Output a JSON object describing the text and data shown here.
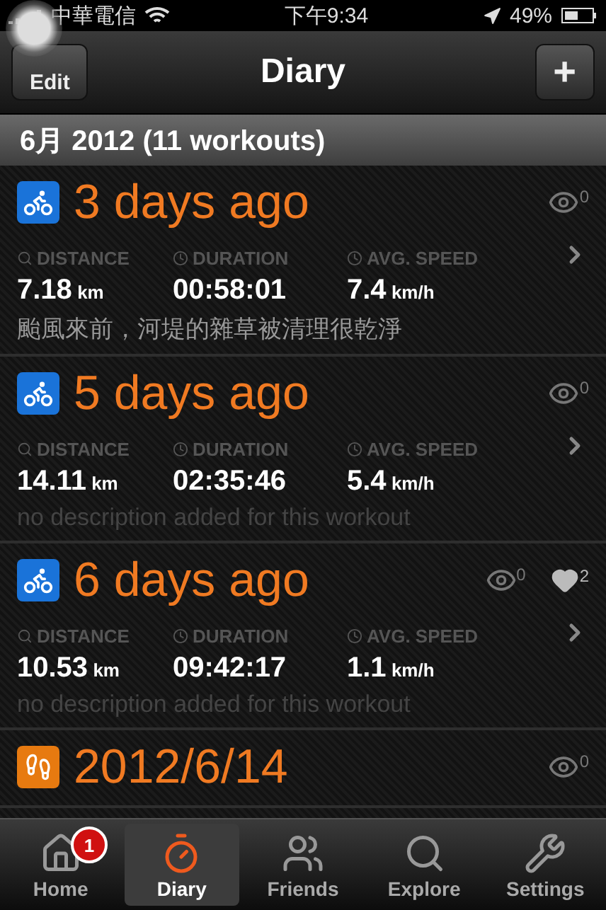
{
  "status_bar": {
    "carrier": "中華電信",
    "time": "下午9:34",
    "battery": "49%"
  },
  "nav": {
    "left_button": "Edit",
    "title": "Diary",
    "right_button": "+"
  },
  "section": {
    "title": "6月 2012 (11 workouts)"
  },
  "workouts": [
    {
      "kind": "bike",
      "title": "3 days ago",
      "views": "0",
      "stats": [
        {
          "label": "DISTANCE",
          "value": "7.18",
          "unit": "km"
        },
        {
          "label": "DURATION",
          "value": "00:58:01"
        },
        {
          "label": "AVG. SPEED",
          "value": "7.4",
          "unit": "km/h"
        }
      ],
      "description": "颱風來前，河堤的雜草被清理很乾淨",
      "description_empty": false
    },
    {
      "kind": "bike",
      "title": "5 days ago",
      "views": "0",
      "stats": [
        {
          "label": "DISTANCE",
          "value": "14.11",
          "unit": "km"
        },
        {
          "label": "DURATION",
          "value": "02:35:46"
        },
        {
          "label": "AVG. SPEED",
          "value": "5.4",
          "unit": "km/h"
        }
      ],
      "description": "no description added for this workout",
      "description_empty": true
    },
    {
      "kind": "bike",
      "title": "6 days ago",
      "views": "0",
      "likes": "2",
      "stats": [
        {
          "label": "DISTANCE",
          "value": "10.53",
          "unit": "km"
        },
        {
          "label": "DURATION",
          "value": "09:42:17"
        },
        {
          "label": "AVG. SPEED",
          "value": "1.1",
          "unit": "km/h"
        }
      ],
      "description": "no description added for this workout",
      "description_empty": true
    },
    {
      "kind": "walk",
      "title": "2012/6/14",
      "views": "0"
    }
  ],
  "tab_bar": [
    {
      "kind": "home",
      "label": "Home",
      "badge": "1",
      "selected": false
    },
    {
      "kind": "diary",
      "label": "Diary",
      "selected": true
    },
    {
      "kind": "friends",
      "label": "Friends",
      "selected": false
    },
    {
      "kind": "explore",
      "label": "Explore",
      "selected": false
    },
    {
      "kind": "settings",
      "label": "Settings",
      "selected": false
    }
  ]
}
